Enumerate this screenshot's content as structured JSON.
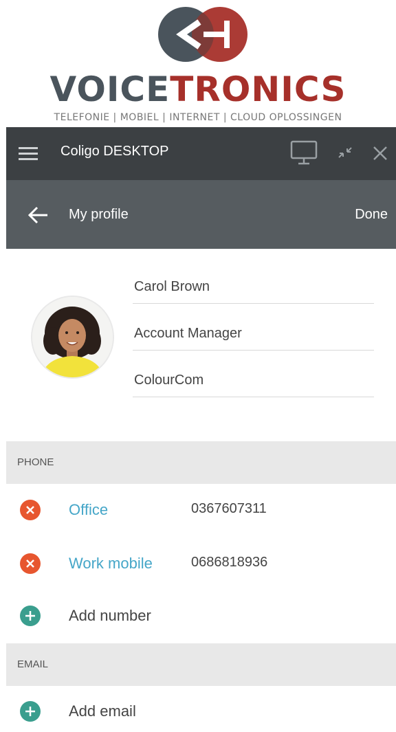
{
  "brand": {
    "name_part1": "VOICE",
    "name_part2": "TRONICS",
    "tagline": "TELEFONIE | MOBIEL | INTERNET | CLOUD OPLOSSINGEN",
    "colors": {
      "grey": "#4a545c",
      "red": "#a6302a"
    }
  },
  "window": {
    "title": "Coligo DESKTOP",
    "icons": [
      "menu-icon",
      "monitor-icon",
      "collapse-icon",
      "close-icon"
    ]
  },
  "header": {
    "title": "My profile",
    "done_label": "Done"
  },
  "profile": {
    "name": "Carol Brown",
    "job_title": "Account Manager",
    "company": "ColourCom"
  },
  "phone_section": {
    "title": "PHONE",
    "numbers": [
      {
        "label": "Office",
        "value": "0367607311"
      },
      {
        "label": "Work mobile",
        "value": "0686818936"
      }
    ],
    "add_label": "Add number"
  },
  "email_section": {
    "title": "EMAIL",
    "add_label": "Add email"
  },
  "colors": {
    "remove": "#e7562f",
    "add": "#3a9e8e",
    "link": "#45a6c8",
    "titlebar": "#3c4043",
    "header": "#565c60"
  }
}
